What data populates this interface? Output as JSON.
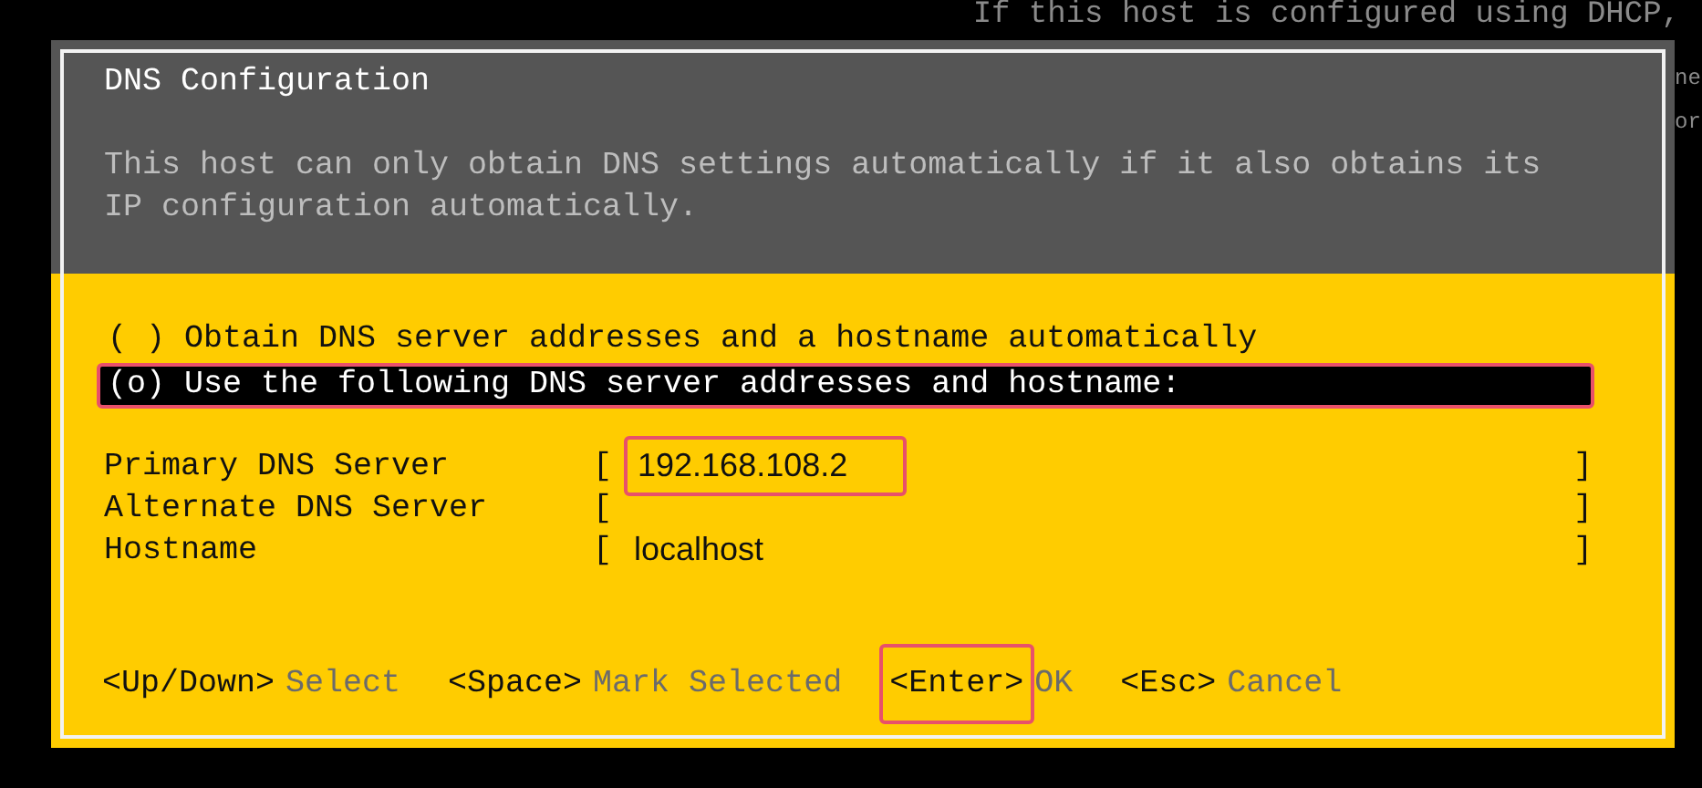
{
  "background_text": "If this host is configured using DHCP,",
  "background_fragments": [
    "ne",
    "or"
  ],
  "dialog": {
    "title": "DNS Configuration",
    "description": "This host can only obtain DNS settings automatically if it also obtains its IP configuration automatically.",
    "options": [
      {
        "label": "( ) Obtain DNS server addresses and a hostname automatically",
        "selected": false,
        "annotated": false
      },
      {
        "label": "(o) Use the following DNS server addresses and hostname:",
        "selected": true,
        "annotated": true
      }
    ],
    "fields": [
      {
        "label": "Primary DNS Server",
        "brackets": [
          "[",
          "]"
        ],
        "value": "192.168.108.2",
        "annotated": true
      },
      {
        "label": "Alternate DNS Server",
        "brackets": [
          "[",
          "]"
        ]
      },
      {
        "label": "Hostname",
        "brackets": [
          "[",
          "]"
        ],
        "value": "localhost",
        "annotated": false
      }
    ],
    "keys": [
      {
        "key": "<Up/Down>",
        "action": "Select",
        "annotated": false
      },
      {
        "key": "<Space>",
        "action": "Mark Selected",
        "annotated": false
      },
      {
        "key": "<Enter>",
        "action": "OK",
        "annotated": true
      },
      {
        "key": "<Esc>",
        "action": "Cancel",
        "annotated": false
      }
    ]
  }
}
